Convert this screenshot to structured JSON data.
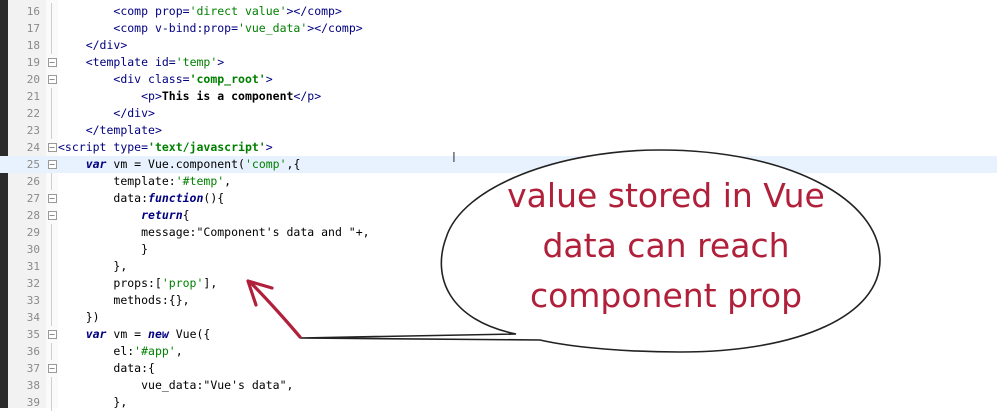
{
  "editor": {
    "lines": [
      {
        "num": "16",
        "segs": [
          [
            "        ",
            ""
          ],
          [
            "<comp ",
            "tag"
          ],
          [
            "prop=",
            "attr"
          ],
          [
            "'direct value'",
            "str"
          ],
          [
            "></comp>",
            "tag"
          ]
        ]
      },
      {
        "num": "17",
        "segs": [
          [
            "        ",
            ""
          ],
          [
            "<comp ",
            "tag"
          ],
          [
            "v-bind:prop=",
            "attr"
          ],
          [
            "'vue_data'",
            "str"
          ],
          [
            "></comp>",
            "tag"
          ]
        ]
      },
      {
        "num": "18",
        "segs": [
          [
            "    ",
            ""
          ],
          [
            "</div>",
            "tag"
          ]
        ]
      },
      {
        "num": "19",
        "segs": [
          [
            "    ",
            ""
          ],
          [
            "<template ",
            "tag"
          ],
          [
            "id=",
            "attr"
          ],
          [
            "'temp'",
            "str"
          ],
          [
            ">",
            "tag"
          ]
        ]
      },
      {
        "num": "20",
        "segs": [
          [
            "        ",
            ""
          ],
          [
            "<div ",
            "tag"
          ],
          [
            "class=",
            "attr"
          ],
          [
            "'comp_root'",
            "strb"
          ],
          [
            ">",
            "tag"
          ]
        ]
      },
      {
        "num": "21",
        "segs": [
          [
            "            ",
            ""
          ],
          [
            "<p>",
            "tag"
          ],
          [
            "This is a component",
            "b"
          ],
          [
            "</p>",
            "tag"
          ]
        ]
      },
      {
        "num": "22",
        "segs": [
          [
            "        ",
            ""
          ],
          [
            "</div>",
            "tag"
          ]
        ]
      },
      {
        "num": "23",
        "segs": [
          [
            "    ",
            ""
          ],
          [
            "</template>",
            "tag"
          ]
        ]
      },
      {
        "num": "24",
        "segs": [
          [
            "",
            ""
          ],
          [
            "<script ",
            "tag"
          ],
          [
            "type=",
            "attr"
          ],
          [
            "'text/javascript'",
            "strb"
          ],
          [
            ">",
            "tag"
          ]
        ]
      },
      {
        "num": "25",
        "segs": [
          [
            "    ",
            ""
          ],
          [
            "var",
            "kw"
          ],
          [
            " vm = Vue.component(",
            ""
          ],
          [
            "'comp'",
            "str"
          ],
          [
            ",{",
            ""
          ]
        ]
      },
      {
        "num": "26",
        "segs": [
          [
            "        ",
            ""
          ],
          [
            "template:",
            ""
          ],
          [
            "'#temp'",
            "str"
          ],
          [
            ",",
            ""
          ]
        ]
      },
      {
        "num": "27",
        "segs": [
          [
            "        ",
            ""
          ],
          [
            "data:",
            ""
          ],
          [
            "function",
            "kw"
          ],
          [
            "(){",
            ""
          ]
        ]
      },
      {
        "num": "28",
        "segs": [
          [
            "            ",
            ""
          ],
          [
            "return",
            "kw"
          ],
          [
            "{",
            ""
          ]
        ]
      },
      {
        "num": "29",
        "segs": [
          [
            "            ",
            ""
          ],
          [
            "message:",
            ""
          ],
          [
            "\"Component's data and \"",
            ""
          ],
          [
            "+,",
            ""
          ]
        ]
      },
      {
        "num": "30",
        "segs": [
          [
            "            ",
            ""
          ],
          [
            "}",
            ""
          ]
        ]
      },
      {
        "num": "31",
        "segs": [
          [
            "        ",
            ""
          ],
          [
            "},",
            ""
          ]
        ]
      },
      {
        "num": "32",
        "segs": [
          [
            "        ",
            ""
          ],
          [
            "props:[",
            ""
          ],
          [
            "'prop'",
            "str"
          ],
          [
            "],",
            ""
          ]
        ]
      },
      {
        "num": "33",
        "segs": [
          [
            "        ",
            ""
          ],
          [
            "methods:{},",
            ""
          ]
        ]
      },
      {
        "num": "34",
        "segs": [
          [
            "    ",
            ""
          ],
          [
            "})",
            ""
          ]
        ]
      },
      {
        "num": "35",
        "segs": [
          [
            "    ",
            ""
          ],
          [
            "var",
            "kw"
          ],
          [
            " vm = ",
            ""
          ],
          [
            "new",
            "kw"
          ],
          [
            " Vue({",
            ""
          ]
        ]
      },
      {
        "num": "36",
        "segs": [
          [
            "        ",
            ""
          ],
          [
            "el:",
            ""
          ],
          [
            "'#app'",
            "str"
          ],
          [
            ",",
            ""
          ]
        ]
      },
      {
        "num": "37",
        "segs": [
          [
            "        ",
            ""
          ],
          [
            "data:{",
            ""
          ]
        ]
      },
      {
        "num": "38",
        "segs": [
          [
            "            ",
            ""
          ],
          [
            "vue_data:",
            ""
          ],
          [
            "\"Vue's data\"",
            ""
          ],
          [
            ",",
            ""
          ]
        ]
      },
      {
        "num": "39",
        "segs": [
          [
            "        ",
            ""
          ],
          [
            "},",
            ""
          ]
        ]
      }
    ],
    "fold_markers": [
      "19",
      "20",
      "24",
      "25",
      "27",
      "28",
      "35",
      "37"
    ],
    "current_line": "25"
  },
  "callout": {
    "lines": [
      "value stored in Vue",
      "data can reach",
      "component prop"
    ],
    "text_color": "#b0203a",
    "arrow_color": "#b0203a"
  },
  "cursor": {
    "icon": "text-cursor-icon",
    "glyph": "I"
  }
}
